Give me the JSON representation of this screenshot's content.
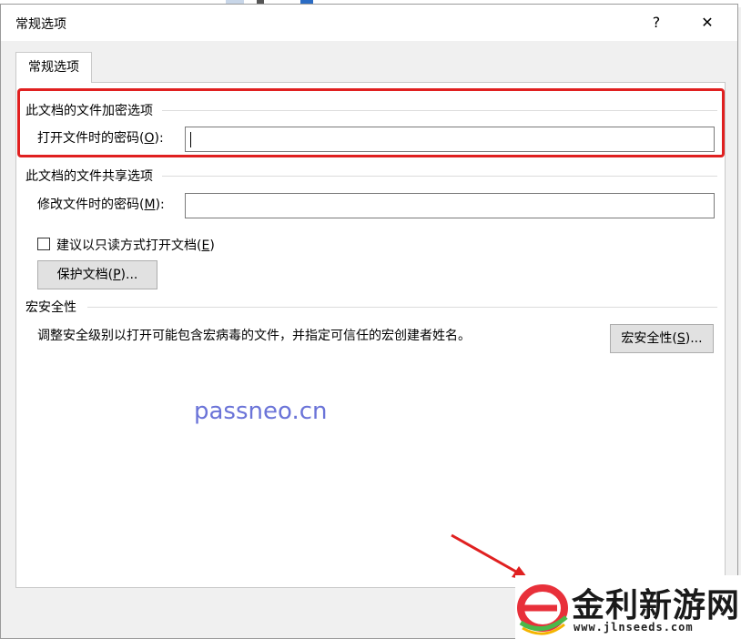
{
  "dialog": {
    "title": "常规选项",
    "help_label": "?",
    "close_label": "✕"
  },
  "tab": {
    "label": "常规选项"
  },
  "encryption": {
    "section_title": "此文档的文件加密选项",
    "open_password_label": "打开文件时的密码(",
    "open_password_key": "O",
    "open_password_suffix": "):",
    "open_password_value": ""
  },
  "sharing": {
    "section_title": "此文档的文件共享选项",
    "modify_password_label": "修改文件时的密码(",
    "modify_password_key": "M",
    "modify_password_suffix": "):",
    "modify_password_value": "",
    "readonly_label": "建议以只读方式打开文档(",
    "readonly_key": "E",
    "readonly_suffix": ")",
    "readonly_checked": false,
    "protect_button_label": "保护文档(",
    "protect_button_key": "P",
    "protect_button_suffix": ")..."
  },
  "macro": {
    "section_title": "宏安全性",
    "description": "调整安全级别以打开可能包含宏病毒的文件，并指定可信任的宏创建者姓名。",
    "button_label": "宏安全性(",
    "button_key": "S",
    "button_suffix": ")..."
  },
  "watermark": "passneo.cn",
  "logo": {
    "title": "金利新游网",
    "url": "www.jlnseeds.com"
  },
  "colors": {
    "highlight": "#e02020",
    "watermark": "#6b74d8",
    "arrow": "#e02020"
  }
}
